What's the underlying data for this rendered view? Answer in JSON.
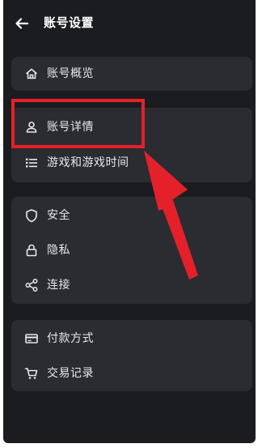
{
  "header": {
    "title": "账号设置",
    "back_icon": "arrow-left-icon"
  },
  "groups": [
    {
      "items": [
        {
          "label": "账号概览",
          "icon": "home-icon"
        }
      ]
    },
    {
      "items": [
        {
          "label": "账号详情",
          "icon": "user-icon"
        },
        {
          "label": "游戏和游戏时间",
          "icon": "list-icon"
        }
      ]
    },
    {
      "items": [
        {
          "label": "安全",
          "icon": "shield-icon"
        },
        {
          "label": "隐私",
          "icon": "lock-icon"
        },
        {
          "label": "连接",
          "icon": "share-icon"
        }
      ]
    },
    {
      "items": [
        {
          "label": "付款方式",
          "icon": "credit-card-icon"
        },
        {
          "label": "交易记录",
          "icon": "cart-icon"
        }
      ]
    }
  ],
  "colors": {
    "background": "#1b1c1f",
    "card": "#2a2c31",
    "text": "#e7e8ea",
    "annotation": "#e4202a"
  }
}
